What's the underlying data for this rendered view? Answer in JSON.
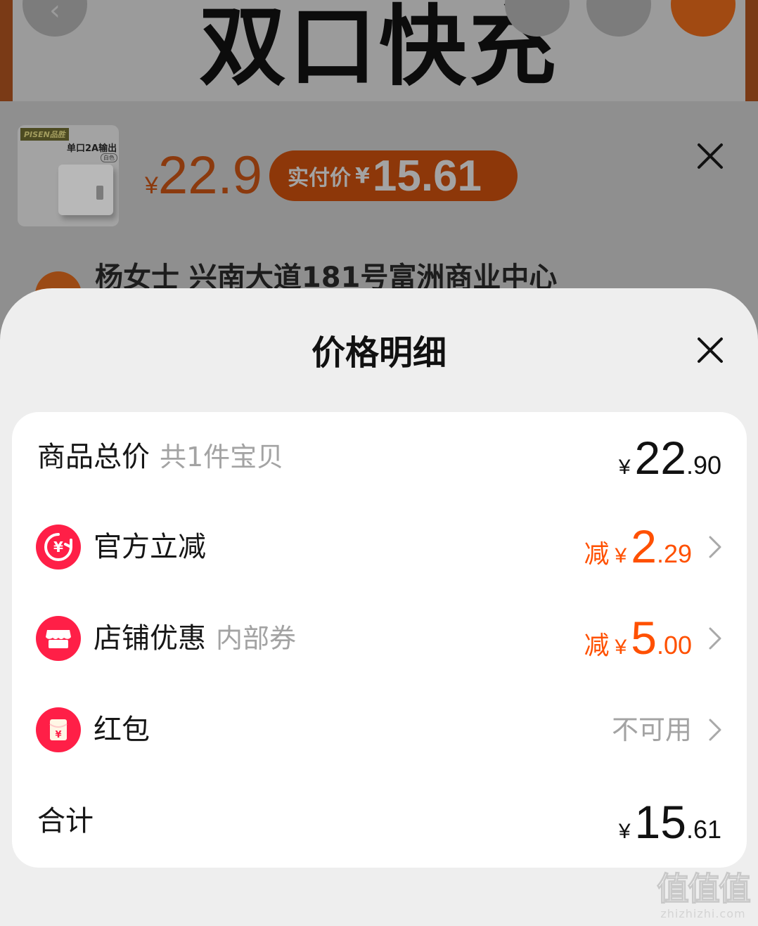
{
  "background": {
    "banner_title": "双口快充",
    "product": {
      "brand_text": "PISEN品胜",
      "image_text": "单口2A输出",
      "image_badge": "白色",
      "price_symbol": "¥",
      "price": "22.9",
      "pay_label": "实付价",
      "pay_symbol": "¥",
      "pay_value": "15.61"
    },
    "address": "杨女士 兴南大道181号富洲商业中心",
    "colors": {
      "accent": "#ff5000",
      "dim_overlay": "rgba(0,0,0,0.4)"
    }
  },
  "sheet": {
    "title": "价格明细",
    "rows": {
      "total": {
        "label": "商品总价",
        "sub": "共1件宝贝",
        "yen": "¥",
        "int": "22",
        "dec": ".90"
      },
      "official": {
        "label": "官方立减",
        "prefix": "减",
        "yen": "¥",
        "int": "2",
        "dec": ".29",
        "icon": "yuan-coupon-icon"
      },
      "shop": {
        "label": "店铺优惠",
        "sub": "内部券",
        "prefix": "减",
        "yen": "¥",
        "int": "5",
        "dec": ".00",
        "icon": "store-icon"
      },
      "redpacket": {
        "label": "红包",
        "status": "不可用",
        "icon": "red-packet-icon"
      },
      "sum": {
        "label": "合计",
        "yen": "¥",
        "int": "15",
        "dec": ".61"
      }
    },
    "colors": {
      "discount": "#ff5000",
      "icon_bg": "#ff1f47",
      "muted": "#a3a3a3"
    }
  },
  "watermark": {
    "logo": "值值值",
    "url": "zhizhizhi.com"
  }
}
